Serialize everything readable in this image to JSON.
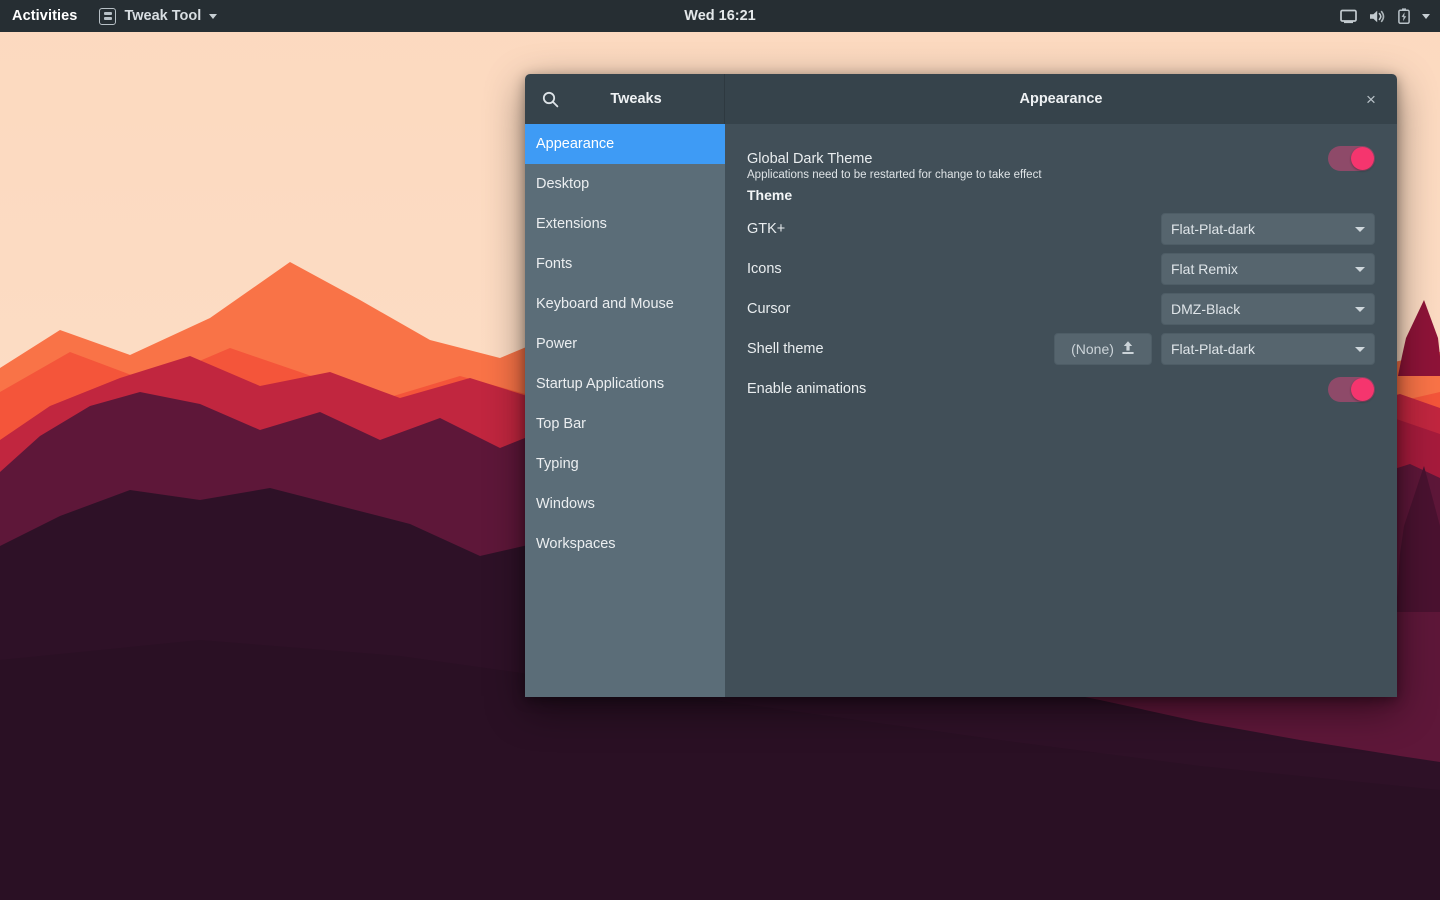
{
  "topbar": {
    "activities": "Activities",
    "app_name": "Tweak Tool",
    "app_icon": "tweak-tool-icon",
    "app_menu_caret": "chevron-down-icon",
    "clock": "Wed 16:21",
    "indicators": [
      {
        "name": "display-icon"
      },
      {
        "name": "volume-icon"
      },
      {
        "name": "battery-charging-icon"
      },
      {
        "name": "chevron-down-icon"
      }
    ]
  },
  "window": {
    "sidebar_title": "Tweaks",
    "search_icon": "search-icon",
    "page_title": "Appearance",
    "close_label": "×"
  },
  "sidebar": {
    "items": [
      {
        "label": "Appearance",
        "active": true
      },
      {
        "label": "Desktop",
        "active": false
      },
      {
        "label": "Extensions",
        "active": false
      },
      {
        "label": "Fonts",
        "active": false
      },
      {
        "label": "Keyboard and Mouse",
        "active": false
      },
      {
        "label": "Power",
        "active": false
      },
      {
        "label": "Startup Applications",
        "active": false
      },
      {
        "label": "Top Bar",
        "active": false
      },
      {
        "label": "Typing",
        "active": false
      },
      {
        "label": "Windows",
        "active": false
      },
      {
        "label": "Workspaces",
        "active": false
      }
    ]
  },
  "main": {
    "global_dark_theme": {
      "label": "Global Dark Theme",
      "description": "Applications need to be restarted for change to take effect",
      "toggle_state": "on"
    },
    "theme_section_header": "Theme",
    "theme_rows": [
      {
        "label": "GTK+",
        "value": "Flat-Plat-dark"
      },
      {
        "label": "Icons",
        "value": "Flat Remix"
      },
      {
        "label": "Cursor",
        "value": "DMZ-Black"
      }
    ],
    "shell_theme": {
      "label": "Shell theme",
      "upload_label": "(None)",
      "upload_icon": "upload-icon",
      "value": "Flat-Plat-dark"
    },
    "enable_animations": {
      "label": "Enable animations",
      "toggle_state": "on"
    }
  },
  "colors": {
    "accent_blue": "#3e9bf5",
    "toggle_on": "#f5356e",
    "toggle_track": "#8e4a69",
    "window_header": "#36434b",
    "sidebar_bg": "#5b6d78",
    "main_bg": "#414f58",
    "topbar_bg": "#262e33"
  }
}
